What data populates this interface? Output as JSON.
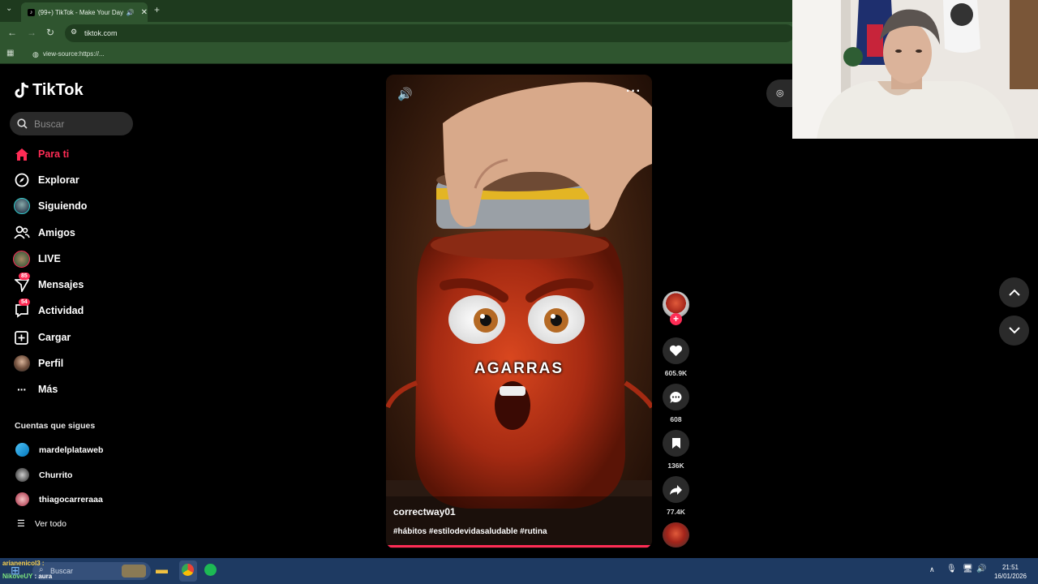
{
  "browser": {
    "tab_title": "(99+) TikTok - Make Your Day",
    "new_tab_symbol": "+",
    "url": "tiktok.com",
    "bookmark": "view-source:https://..."
  },
  "sidebar": {
    "logo": "TikTok",
    "search_placeholder": "Buscar",
    "items": [
      {
        "label": "Para ti",
        "active": true,
        "icon": "home-icon"
      },
      {
        "label": "Explorar",
        "icon": "compass-icon"
      },
      {
        "label": "Siguiendo",
        "icon": "following-avatar"
      },
      {
        "label": "Amigos",
        "icon": "friends-icon"
      },
      {
        "label": "LIVE",
        "icon": "live-avatar"
      },
      {
        "label": "Mensajes",
        "badge": "85",
        "icon": "send-icon"
      },
      {
        "label": "Actividad",
        "badge": "54",
        "icon": "activity-icon"
      },
      {
        "label": "Cargar",
        "icon": "upload-icon"
      },
      {
        "label": "Perfil",
        "icon": "profile-avatar"
      },
      {
        "label": "Más",
        "icon": "more-icon"
      }
    ],
    "following_title": "Cuentas que sigues",
    "following": [
      "mardelplataweb",
      "Churrito",
      "thiagocarreraaa"
    ],
    "see_all": "Ver todo"
  },
  "video": {
    "caption_overlay": "AGARRAS",
    "author": "correctway01",
    "hashtags": "#hábitos #estilodevidasaludable #rutina",
    "progress": 0.0
  },
  "actions": {
    "likes": "605.9K",
    "comments": "608",
    "saves": "136K",
    "shares": "77.4K"
  },
  "chat": {
    "line1": "arianenicol3 :",
    "line2_user": "NikoveUY",
    "line2_text": ": aura"
  },
  "taskbar": {
    "search": "Buscar",
    "time": "21:51",
    "date": "16/01/2026"
  },
  "colors": {
    "accent": "#fe2c55",
    "browser_bg": "#2f552f",
    "taskbar": "#1e3a62"
  }
}
